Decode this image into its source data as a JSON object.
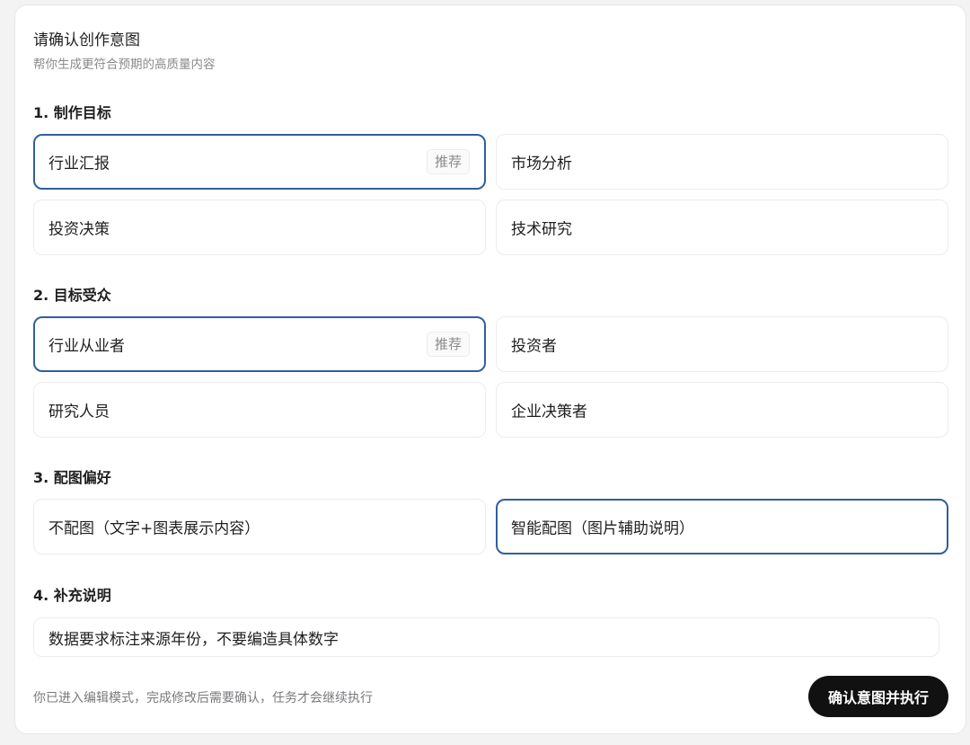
{
  "header": {
    "title": "请确认创作意图",
    "subtitle": "帮你生成更符合预期的高质量内容"
  },
  "sections": [
    {
      "title": "1. 制作目标",
      "options": [
        {
          "label": "行业汇报",
          "badge": "推荐",
          "selected": true
        },
        {
          "label": "市场分析",
          "selected": false
        },
        {
          "label": "投资决策",
          "selected": false
        },
        {
          "label": "技术研究",
          "selected": false
        }
      ]
    },
    {
      "title": "2. 目标受众",
      "options": [
        {
          "label": "行业从业者",
          "badge": "推荐",
          "selected": true
        },
        {
          "label": "投资者",
          "selected": false
        },
        {
          "label": "研究人员",
          "selected": false
        },
        {
          "label": "企业决策者",
          "selected": false
        }
      ]
    },
    {
      "title": "3. 配图偏好",
      "options": [
        {
          "label": "不配图（文字+图表展示内容）",
          "selected": false
        },
        {
          "label": "智能配图（图片辅助说明）",
          "selected": true
        }
      ]
    },
    {
      "title": "4. 补充说明",
      "input_value": "数据要求标注来源年份，不要编造具体数字"
    }
  ],
  "footer": {
    "hint": "你已进入编辑模式，完成修改后需要确认，任务才会继续执行",
    "confirm_label": "确认意图并执行"
  },
  "colors": {
    "selected_border": "#2f5f9e",
    "button_bg": "#111111",
    "button_text": "#ffffff"
  }
}
